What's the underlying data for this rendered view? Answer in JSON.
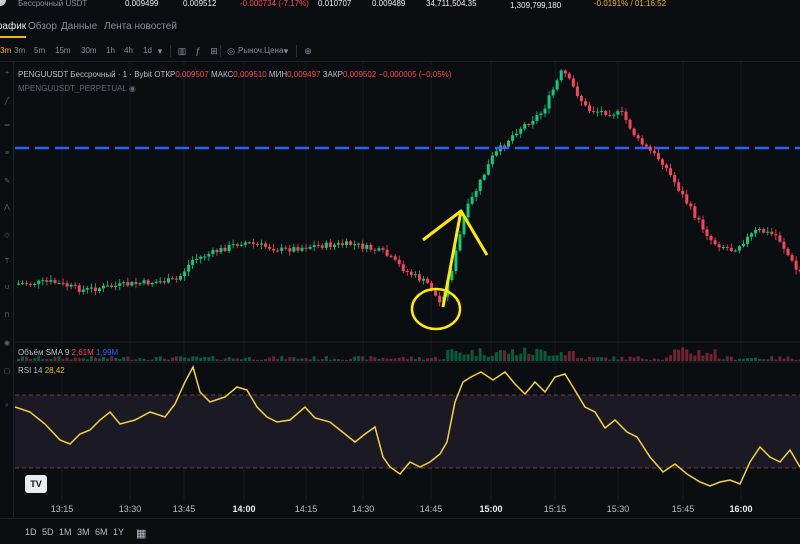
{
  "ticker": {
    "type_label": "Бессрочный USDT",
    "values": [
      "0.009499",
      "0.009512",
      "-0.000734 (-7.17%)",
      "0.010707",
      "0.009489",
      "34,711,504.35",
      "1,309,799,180",
      "-0.0191% / 01:16:52"
    ]
  },
  "tabs": [
    "График",
    "Обзор",
    "Данные",
    "Лента новостей"
  ],
  "timeframes": [
    "3m",
    "5m",
    "15m",
    "30m",
    "1h",
    "4h",
    "1d"
  ],
  "active_timeframe": "3m",
  "price_type_label": "Рыноч.Цена",
  "legend": {
    "symbol": "PENGUUSDT Бессрочный · 1 · Bybit",
    "open_k": "ОТКР",
    "open_v": "0,009507",
    "high_k": "МАКС",
    "high_v": "0,009510",
    "low_k": "МИН",
    "low_v": "0,009497",
    "close_k": "ЗАКР",
    "close_v": "0,009502",
    "change_v": "−0,000005 (−0,05%)",
    "sub": "MPENGUUSDT_PERPETUAL"
  },
  "volume_legend": {
    "label": "Объём SMA 9",
    "v1": "2,61M",
    "v2": "1,99M"
  },
  "rsi_legend": {
    "label": "RSI 14",
    "value": "28,42"
  },
  "tv_logo": "TV",
  "time_axis": [
    "13:15",
    "13:30",
    "13:45",
    "14:00",
    "14:15",
    "14:30",
    "14:45",
    "15:00",
    "15:15",
    "15:30",
    "15:45",
    "16:00"
  ],
  "bold_times": [
    "14:00",
    "15:00",
    "16:00"
  ],
  "ranges": [
    "1D",
    "5D",
    "1M",
    "3M",
    "6M",
    "1Y"
  ],
  "colors": {
    "up": "#0ecb81",
    "down": "#f6465d",
    "line": "#2962ff",
    "rsi": "#f0d43a",
    "annot": "#ffeb00"
  }
}
